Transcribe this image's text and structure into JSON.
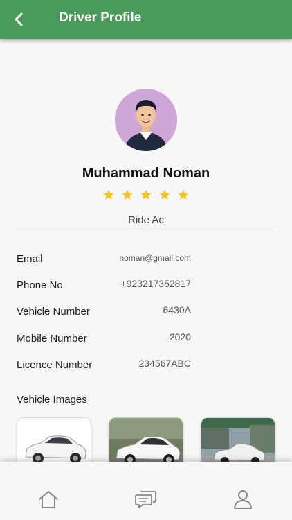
{
  "app_bar": {
    "title": "Driver Profile",
    "back_icon": "back-arrow-icon",
    "color": "#4a9a5a"
  },
  "profile": {
    "name": "Muhammad Noman",
    "rating": 5,
    "rating_max": 5,
    "star_color": "#f5c518",
    "ride_type": "Ride Ac"
  },
  "details": [
    {
      "label": "Email",
      "value": "noman@gmail.com"
    },
    {
      "label": "Phone No",
      "value": "+923217352817"
    },
    {
      "label": "Vehicle Number",
      "value": "6430A"
    },
    {
      "label": "Mobile Number",
      "value": "2020"
    },
    {
      "label": "Licence Number",
      "value": "234567ABC"
    }
  ],
  "vehicle_images": {
    "title": "Vehicle Images",
    "images": [
      "white-hatchback-studio",
      "white-sedan-outdoor",
      "white-sedan-street"
    ]
  },
  "bottom_nav": {
    "items": [
      "home-icon",
      "chat-icon",
      "profile-icon"
    ]
  }
}
